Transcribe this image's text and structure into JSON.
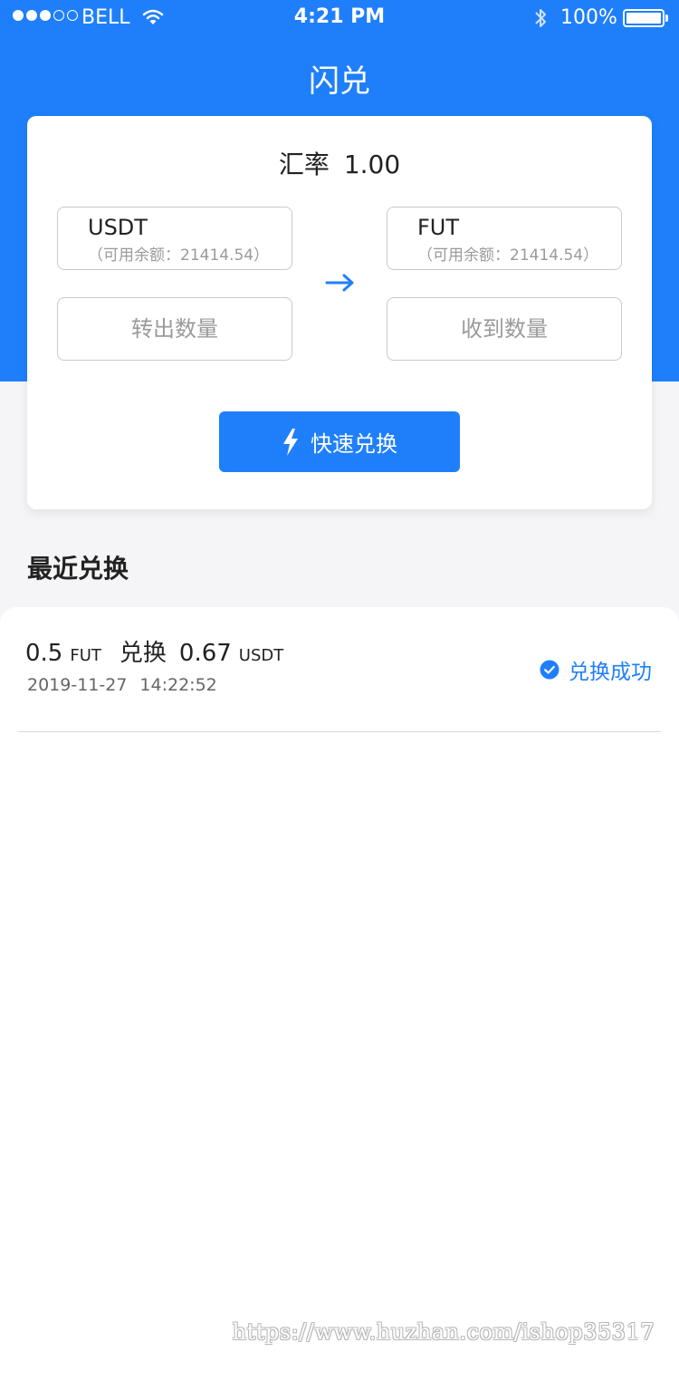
{
  "status_bar": {
    "carrier": "BELL",
    "time": "4:21 PM",
    "battery": "100%",
    "battery_level": 1.0,
    "signal_bars": 3,
    "signal_max": 5,
    "icons": [
      "signal-dots-icon",
      "wifi-icon",
      "bluetooth-icon",
      "battery-icon"
    ]
  },
  "nav": {
    "title": "闪兑"
  },
  "exchange": {
    "rate_label": "汇率",
    "rate_value": "1.00",
    "from": {
      "coin": "USDT",
      "balance": "（可用余额：21414.54）"
    },
    "to": {
      "coin": "FUT",
      "balance": "（可用余额：21414.54）"
    },
    "from_amount": {
      "value": "",
      "placeholder": "转出数量"
    },
    "to_amount": {
      "value": "",
      "placeholder": "收到数量"
    },
    "direction_icon": "arrow-right-icon",
    "button_icon": "lightning-icon",
    "button_label": "快速兑换"
  },
  "recent": {
    "title": "最近兑换",
    "records": [
      {
        "from_amount": "0.5",
        "from_unit": "FUT",
        "verb": "兑换",
        "to_amount": "0.67",
        "to_unit": "USDT",
        "date": "2019-11-27",
        "time": "14:22:52",
        "status": "兑换成功",
        "status_icon": "check-circle-icon"
      }
    ]
  },
  "watermark": "https://www.huzhan.com/ishop35317",
  "colors": {
    "primary": "#1f7ffb",
    "background": "#f5f5f7",
    "text": "#222222",
    "muted": "#9a9a9a"
  }
}
